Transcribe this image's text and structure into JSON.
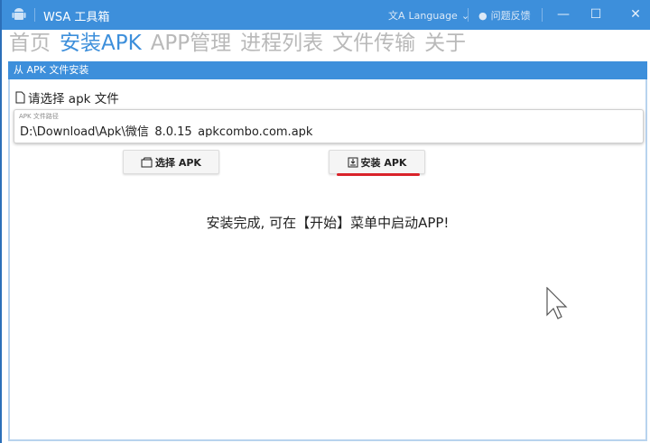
{
  "window": {
    "title": "WSA 工具箱",
    "language_label": "Language",
    "feedback_label": "问题反馈",
    "accent": "#3d8fdb"
  },
  "nav": {
    "items": [
      "首页",
      "安装APK",
      "APP管理",
      "进程列表",
      "文件传输",
      "关于"
    ],
    "active": 1
  },
  "panel": {
    "header": "从 APK 文件安装",
    "choose_label": "请选择 apk 文件",
    "path_label": "APK 文件路径",
    "path_value": "D:\\Download\\Apk\\微信_8.0.15_apkcombo.com.apk",
    "select_button": "选择 APK",
    "install_button": "安装 APK",
    "status_message": "安装完成, 可在【开始】菜单中启动APP!"
  }
}
